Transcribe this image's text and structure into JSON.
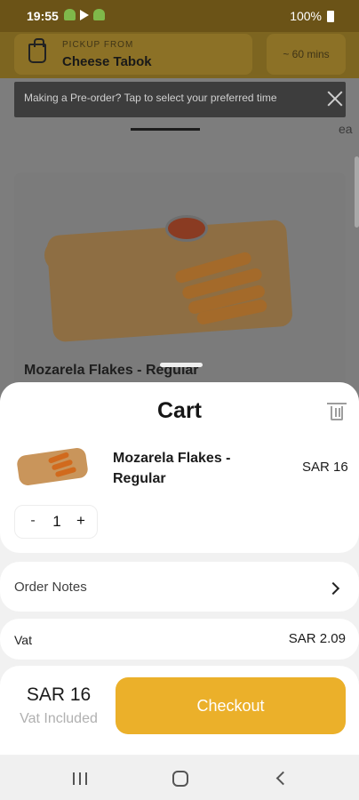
{
  "status_bar": {
    "time": "19:55",
    "battery": "100%"
  },
  "header": {
    "pickup_label": "PICKUP FROM",
    "pickup_name": "Cheese Tabok",
    "time_estimate": "~ 60 mins"
  },
  "tooltip": {
    "text": "Making a Pre-order? Tap to select your preferred time"
  },
  "tabs": {
    "partial_text": "ea"
  },
  "product": {
    "title": "Mozarela Flakes - Regular"
  },
  "cart": {
    "title": "Cart",
    "items": [
      {
        "name": "Mozarela Flakes - Regular",
        "price": "SAR 16",
        "quantity": "1"
      }
    ],
    "stepper_minus": "-",
    "stepper_plus": "+"
  },
  "order_notes": {
    "label": "Order Notes"
  },
  "vat": {
    "label": "Vat",
    "value": "SAR 2.09"
  },
  "totals": {
    "amount": "SAR 16",
    "note": "Vat Included",
    "checkout_label": "Checkout"
  },
  "icons": {
    "bag": "shopping-bag-icon",
    "close": "close-icon",
    "trash": "trash-icon",
    "chevron": "chevron-right-icon",
    "nav_recent": "recent-apps-icon",
    "nav_home": "home-icon",
    "nav_back": "back-icon"
  },
  "colors": {
    "accent": "#ebb02a",
    "sheet_bg": "#f1f1f1",
    "overlay": "#7d7d7d"
  }
}
